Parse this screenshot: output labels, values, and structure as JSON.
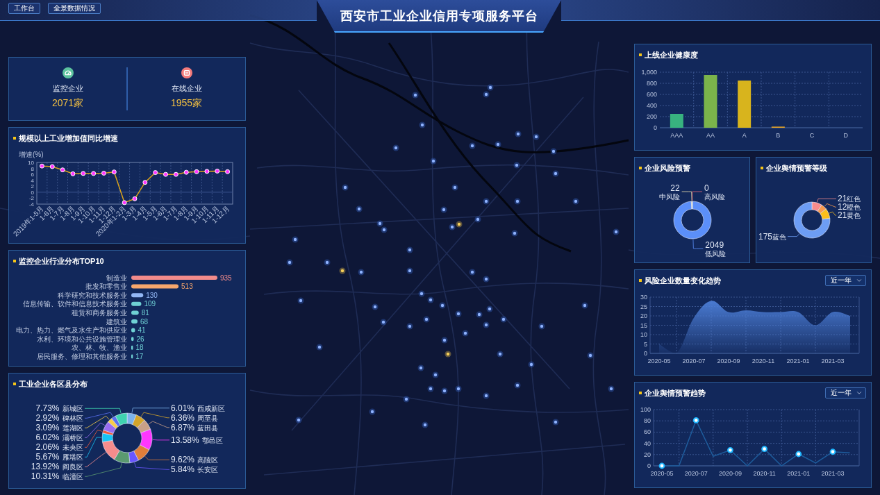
{
  "header": {
    "buttons": [
      "工作台",
      "全景数据情况"
    ],
    "title": "西安市工业企业信用专项服务平台"
  },
  "stats": {
    "items": [
      {
        "kind": "gauge",
        "color": "#5cc29e",
        "label": "监控企业",
        "value": "2071家"
      },
      {
        "kind": "card",
        "color": "#f37b7b",
        "label": "在线企业",
        "value": "1955家"
      }
    ]
  },
  "growth": {
    "title": "规模以上工业增加值同比增速",
    "chart_data": {
      "type": "line",
      "ylabel": "增速(%)",
      "categories": [
        "2019年1-5月",
        "1-6月",
        "1-7月",
        "1-8月",
        "1-9月",
        "1-10月",
        "1-11月",
        "1-12月",
        "2020年1-2月",
        "1-3月",
        "1-4月",
        "1-5月",
        "1-6月",
        "1-7月",
        "1-8月",
        "1-9月",
        "1-10月",
        "1-11月",
        "1-12月"
      ],
      "series": [
        {
          "color": "#d9a21b",
          "marker": true,
          "values": [
            8.8,
            8.6,
            7.5,
            6.2,
            6.3,
            6.3,
            6.4,
            6.8,
            -3.5,
            -2.2,
            3.3,
            6.6,
            6.0,
            6.0,
            6.7,
            6.9,
            7.0,
            7.1,
            6.9
          ]
        }
      ],
      "ylim": [
        -4,
        10
      ],
      "yticks": [
        10,
        8,
        6,
        4,
        2,
        0,
        -2,
        -4
      ],
      "grid": true,
      "ref_lines": [
        {
          "axis": "y",
          "value": 0
        }
      ]
    }
  },
  "industry_top10": {
    "title": "监控企业行业分布TOP10",
    "chart_data": {
      "type": "bar",
      "orientation": "horizontal",
      "categories": [
        "制造业",
        "批发和零售业",
        "科学研究和技术服务业",
        "信息传输、软件和信息技术服务业",
        "租赁和商务服务业",
        "建筑业",
        "电力、热力、燃气及水生产和供应业",
        "水利、环境和公共设施管理业",
        "农、林、牧、渔业",
        "居民服务、修理和其他服务业"
      ],
      "values": [
        935,
        513,
        130,
        109,
        81,
        68,
        41,
        26,
        18,
        17
      ],
      "colors": [
        "#f28b8b",
        "#f7a66c",
        "#93b7f5",
        "#6fd0d4",
        "#6fd0d4",
        "#6fd0d4",
        "#6fd0d4",
        "#6fd0d4",
        "#6fd0d4",
        "#6fd0d4"
      ],
      "data_labels": true
    }
  },
  "districts": {
    "title": "工业企业各区县分布",
    "chart_data": {
      "type": "donut",
      "categories": [
        "西咸新区",
        "周至县",
        "蓝田县",
        "鄠邑区",
        "高陵区",
        "长安区",
        "临潼区",
        "阎良区",
        "雁塔区",
        "未央区",
        "灞桥区",
        "莲湖区",
        "碑林区",
        "新城区"
      ],
      "values": [
        6.01,
        6.36,
        6.87,
        13.58,
        9.62,
        5.84,
        10.31,
        13.92,
        5.67,
        2.06,
        6.02,
        3.09,
        2.92,
        7.73
      ],
      "value_labels": [
        "6.01%",
        "6.36%",
        "6.87%",
        "13.58%",
        "9.62%",
        "5.84%",
        "10.31%",
        "13.92%",
        "5.67%",
        "2.06%",
        "6.02%",
        "3.09%",
        "2.92%",
        "7.73%"
      ],
      "colors": [
        "#7cb3ec",
        "#d4a52a",
        "#c9a088",
        "#ff37ff",
        "#e07e3a",
        "#6a56ff",
        "#5a9a70",
        "#f68c8c",
        "#17c5f5",
        "#f05a3c",
        "#9a6cf2",
        "#f7cd4a",
        "#5a70f0",
        "#3fd3b0"
      ]
    }
  },
  "health": {
    "title": "上线企业健康度",
    "chart_data": {
      "type": "bar",
      "orientation": "vertical",
      "categories": [
        "AAA",
        "AA",
        "A",
        "B",
        "C",
        "D"
      ],
      "values": [
        250,
        950,
        850,
        20,
        0,
        0
      ],
      "colors": [
        "#38b27f",
        "#7bb44b",
        "#d8b41d",
        "#e6a426",
        null,
        null
      ],
      "ylim": [
        0,
        1000
      ],
      "yticks": [
        0,
        200,
        400,
        600,
        800,
        {
          "value": 1000,
          "label": "1,000"
        }
      ],
      "grid": true
    }
  },
  "risk_warning": {
    "title": "企业风险预警",
    "chart_data": {
      "type": "donut",
      "categories": [
        "低风险",
        "中风险",
        "高风险"
      ],
      "values": [
        2049,
        22,
        0
      ],
      "value_labels": [
        "2049",
        "22",
        "0"
      ],
      "colors": [
        "#5b8ff9",
        "#efe3b0",
        "#e8687a"
      ]
    }
  },
  "sentiment_level": {
    "title": "企业舆情预警等级",
    "chart_data": {
      "type": "donut",
      "categories": [
        "红色",
        "橙色",
        "黄色",
        "蓝色"
      ],
      "values": [
        21,
        12,
        21,
        175
      ],
      "value_labels": [
        "21",
        "12",
        "21",
        "175"
      ],
      "colors": [
        "#f78b8b",
        "#f6994c",
        "#fbbf1c",
        "#6d9df4"
      ]
    }
  },
  "risk_trend": {
    "title": "风险企业数量变化趋势",
    "period_dropdown": {
      "value": "近一年"
    },
    "chart_data": {
      "type": "area",
      "categories": [
        "2020-05",
        null,
        "2020-07",
        null,
        "2020-09",
        null,
        "2020-11",
        null,
        "2021-01",
        null,
        "2021-03",
        null
      ],
      "series": [
        {
          "color": "#4d7fd8",
          "values": [
            5,
            0,
            19,
            28,
            22,
            23,
            22,
            22,
            22,
            15,
            22,
            20
          ]
        }
      ],
      "ylim": [
        0,
        30
      ],
      "yticks": [
        0,
        5,
        10,
        15,
        20,
        25,
        30
      ],
      "grid": true
    }
  },
  "sentiment_trend": {
    "title": "企业舆情预警趋势",
    "period_dropdown": {
      "value": "近一年"
    },
    "chart_data": {
      "type": "line",
      "categories": [
        "2020-05",
        null,
        "2020-07",
        null,
        "2020-09",
        null,
        "2020-11",
        null,
        "2021-01",
        null,
        "2021-03",
        null
      ],
      "series": [
        {
          "color": "#1e5c9c",
          "marker": true,
          "values": [
            0,
            0,
            81,
            17,
            28,
            0,
            30,
            0,
            21,
            5,
            25,
            23
          ]
        }
      ],
      "ylim": [
        0,
        100
      ],
      "yticks": [
        0,
        20,
        40,
        60,
        80,
        100
      ],
      "grid": true
    }
  }
}
